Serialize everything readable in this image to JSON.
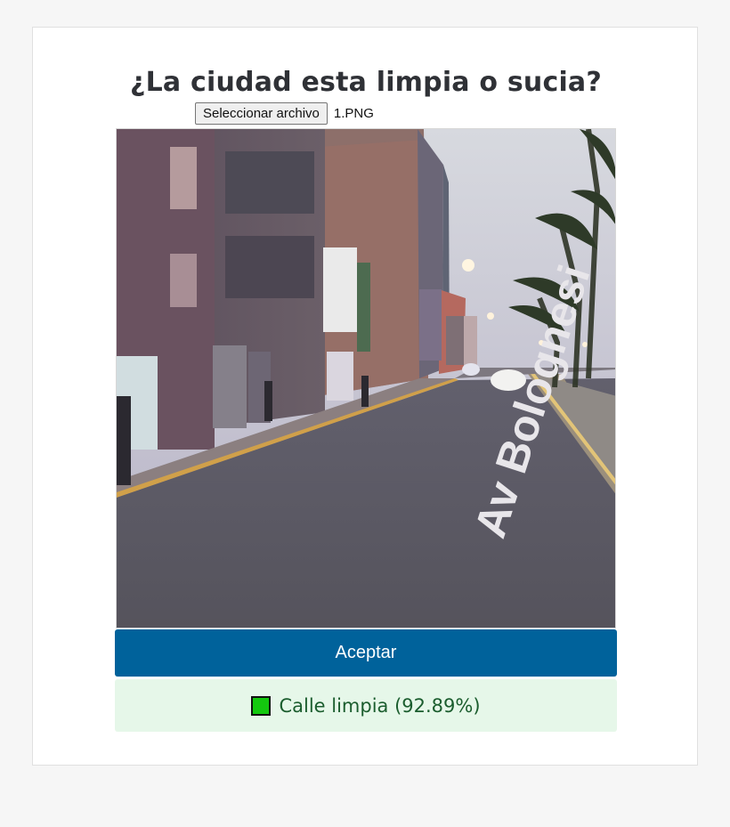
{
  "page": {
    "title": "¿La ciudad esta limpia o sucia?"
  },
  "file_input": {
    "button_label": "Seleccionar archivo",
    "file_name": "1.PNG"
  },
  "image": {
    "street_sign_text": "Av Bolognesi"
  },
  "actions": {
    "accept_label": "Aceptar"
  },
  "result": {
    "text": "Calle limpia (92.89%)",
    "swatch_color": "#14c80f"
  }
}
